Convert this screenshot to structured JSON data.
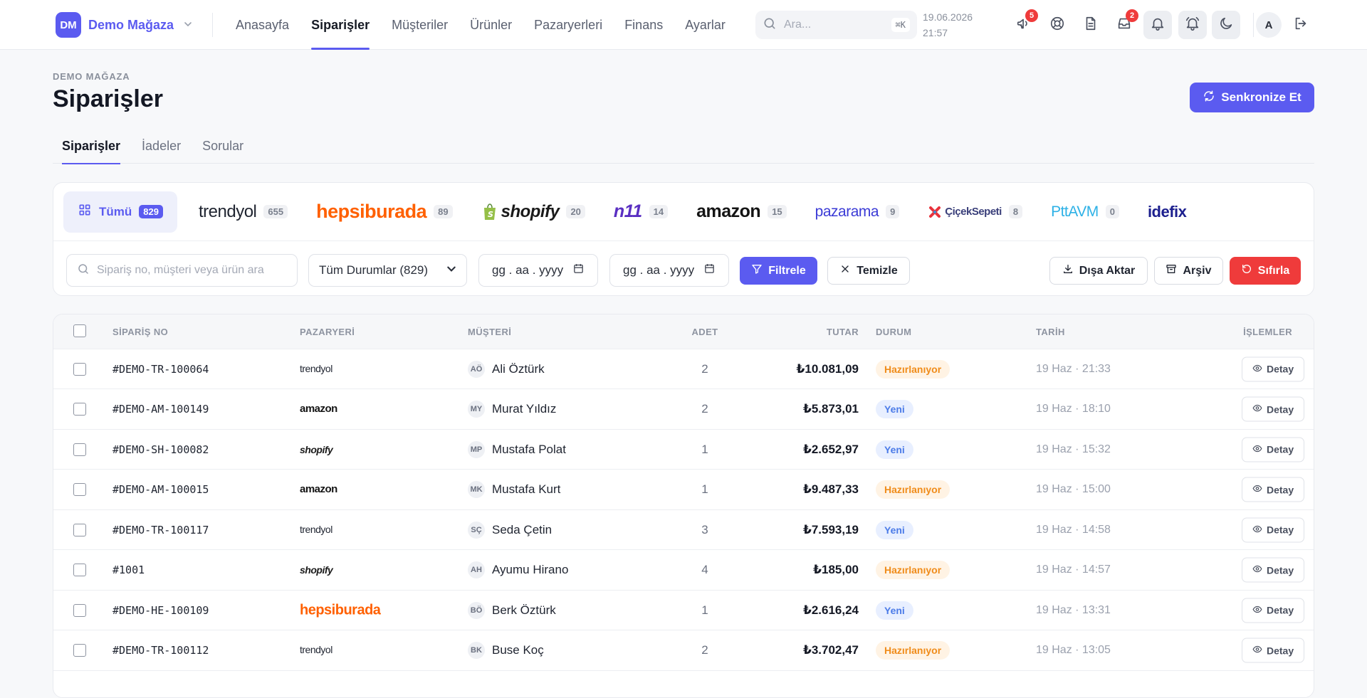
{
  "brand": {
    "initials": "DM",
    "name": "Demo Mağaza"
  },
  "nav": [
    {
      "label": "Anasayfa",
      "active": false
    },
    {
      "label": "Siparişler",
      "active": true
    },
    {
      "label": "Müşteriler",
      "active": false
    },
    {
      "label": "Ürünler",
      "active": false
    },
    {
      "label": "Pazaryerleri",
      "active": false
    },
    {
      "label": "Finans",
      "active": false
    },
    {
      "label": "Ayarlar",
      "active": false
    }
  ],
  "search": {
    "placeholder": "Ara...",
    "shortcut": "⌘K"
  },
  "datetime": {
    "date": "19.06.2026",
    "time": "21:57"
  },
  "notifications": {
    "announcements": "5",
    "inbox": "2"
  },
  "user": {
    "initial": "A"
  },
  "page": {
    "breadcrumb": "DEMO MAĞAZA",
    "title": "Siparişler",
    "sync_label": "Senkronize Et"
  },
  "subtabs": [
    {
      "label": "Siparişler",
      "active": true
    },
    {
      "label": "İadeler",
      "active": false
    },
    {
      "label": "Sorular",
      "active": false
    }
  ],
  "marketplaces": {
    "all": {
      "label": "Tümü",
      "count": "829"
    },
    "trendyol": {
      "label": "trendyol",
      "count": "655"
    },
    "hepsiburada": {
      "label": "hepsiburada",
      "count": "89"
    },
    "shopify": {
      "label": "shopify",
      "count": "20"
    },
    "n11": {
      "label": "n11",
      "count": "14"
    },
    "amazon": {
      "label": "amazon",
      "count": "15"
    },
    "pazarama": {
      "label": "pazarama",
      "count": "9"
    },
    "ciceksepeti": {
      "label": "ÇiçekSepeti",
      "count": "8"
    },
    "pttavm": {
      "label": "PttAVM",
      "count": "0"
    },
    "idefix": {
      "label": "idefix",
      "count": ""
    }
  },
  "filters": {
    "search_placeholder": "Sipariş no, müşteri veya ürün ara",
    "status_selected": "Tüm Durumlar (829)",
    "date_placeholder": "gg . aa . yyyy",
    "filter_label": "Filtrele",
    "clear_label": "Temizle",
    "export_label": "Dışa Aktar",
    "archive_label": "Arşiv",
    "reset_label": "Sıfırla"
  },
  "table": {
    "columns": {
      "order_no": "SİPARİŞ NO",
      "marketplace": "PAZARYERİ",
      "customer": "MÜŞTERİ",
      "qty": "ADET",
      "amount": "TUTAR",
      "status": "DURUM",
      "date": "TARİH",
      "actions": "İŞLEMLER"
    },
    "detail_label": "Detay",
    "rows": [
      {
        "order_no": "#DEMO-TR-100064",
        "marketplace": "trendyol",
        "initials": "AÖ",
        "customer": "Ali Öztürk",
        "qty": "2",
        "amount": "₺10.081,09",
        "status": "Hazırlanıyor",
        "status_kind": "prep",
        "date": "19 Haz · 21:33"
      },
      {
        "order_no": "#DEMO-AM-100149",
        "marketplace": "amazon",
        "initials": "MY",
        "customer": "Murat Yıldız",
        "qty": "2",
        "amount": "₺5.873,01",
        "status": "Yeni",
        "status_kind": "new",
        "date": "19 Haz · 18:10"
      },
      {
        "order_no": "#DEMO-SH-100082",
        "marketplace": "shopify",
        "initials": "MP",
        "customer": "Mustafa Polat",
        "qty": "1",
        "amount": "₺2.652,97",
        "status": "Yeni",
        "status_kind": "new",
        "date": "19 Haz · 15:32"
      },
      {
        "order_no": "#DEMO-AM-100015",
        "marketplace": "amazon",
        "initials": "MK",
        "customer": "Mustafa Kurt",
        "qty": "1",
        "amount": "₺9.487,33",
        "status": "Hazırlanıyor",
        "status_kind": "prep",
        "date": "19 Haz · 15:00"
      },
      {
        "order_no": "#DEMO-TR-100117",
        "marketplace": "trendyol",
        "initials": "SÇ",
        "customer": "Seda Çetin",
        "qty": "3",
        "amount": "₺7.593,19",
        "status": "Yeni",
        "status_kind": "new",
        "date": "19 Haz · 14:58"
      },
      {
        "order_no": "#1001",
        "marketplace": "shopify",
        "initials": "AH",
        "customer": "Ayumu Hirano",
        "qty": "4",
        "amount": "₺185,00",
        "status": "Hazırlanıyor",
        "status_kind": "prep",
        "date": "19 Haz · 14:57"
      },
      {
        "order_no": "#DEMO-HE-100109",
        "marketplace": "hepsiburada",
        "initials": "BÖ",
        "customer": "Berk Öztürk",
        "qty": "1",
        "amount": "₺2.616,24",
        "status": "Yeni",
        "status_kind": "new",
        "date": "19 Haz · 13:31"
      },
      {
        "order_no": "#DEMO-TR-100112",
        "marketplace": "trendyol",
        "initials": "BK",
        "customer": "Buse Koç",
        "qty": "2",
        "amount": "₺3.702,47",
        "status": "Hazırlanıyor",
        "status_kind": "prep",
        "date": "19 Haz · 13:05"
      }
    ]
  },
  "colors": {
    "accent": "#5b5bf0",
    "danger": "#ef3b3b",
    "prep": "#f08c1a",
    "new": "#4b7be8"
  }
}
